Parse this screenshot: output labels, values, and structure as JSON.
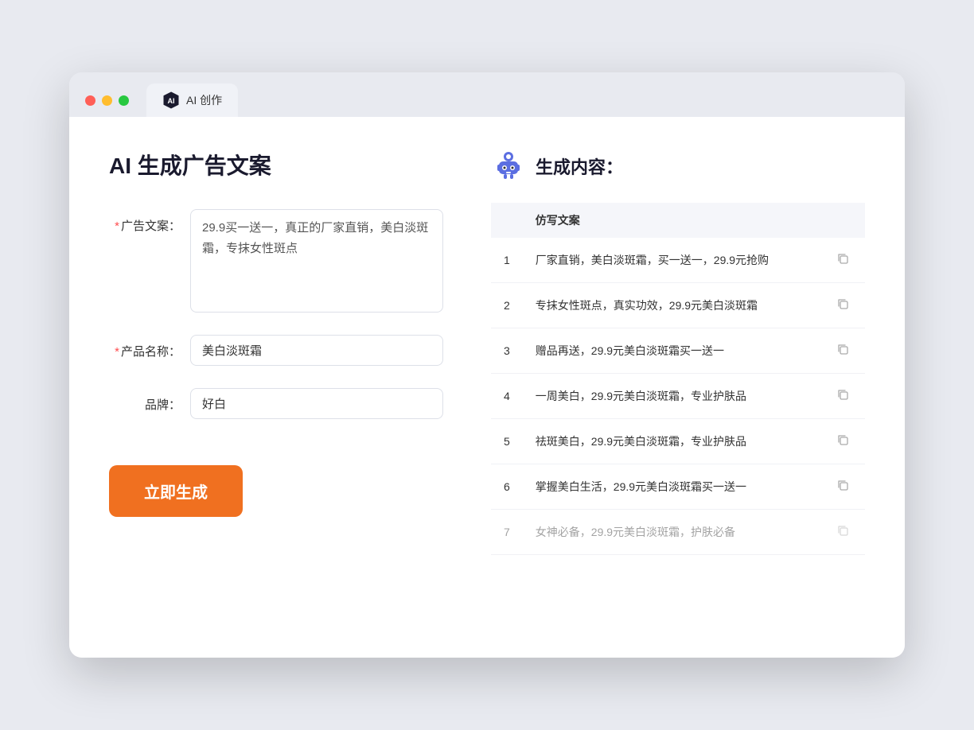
{
  "window": {
    "tab_label": "AI 创作"
  },
  "left": {
    "page_title": "AI 生成广告文案",
    "fields": [
      {
        "label": "广告文案：",
        "required": true,
        "type": "textarea",
        "value": "29.9买一送一，真正的厂家直销，美白淡斑霜，专抹女性斑点",
        "name": "ad-copy-input"
      },
      {
        "label": "产品名称：",
        "required": true,
        "type": "input",
        "value": "美白淡斑霜",
        "name": "product-name-input"
      },
      {
        "label": "品牌：",
        "required": false,
        "type": "input",
        "value": "好白",
        "name": "brand-input"
      }
    ],
    "generate_btn": "立即生成"
  },
  "right": {
    "title": "生成内容：",
    "table_header": "仿写文案",
    "results": [
      {
        "num": "1",
        "text": "厂家直销，美白淡斑霜，买一送一，29.9元抢购"
      },
      {
        "num": "2",
        "text": "专抹女性斑点，真实功效，29.9元美白淡斑霜"
      },
      {
        "num": "3",
        "text": "赠品再送，29.9元美白淡斑霜买一送一"
      },
      {
        "num": "4",
        "text": "一周美白，29.9元美白淡斑霜，专业护肤品"
      },
      {
        "num": "5",
        "text": "祛斑美白，29.9元美白淡斑霜，专业护肤品"
      },
      {
        "num": "6",
        "text": "掌握美白生活，29.9元美白淡斑霜买一送一"
      },
      {
        "num": "7",
        "text": "女神必备，29.9元美白淡斑霜，护肤必备"
      }
    ]
  },
  "colors": {
    "orange": "#f07020",
    "purple": "#6c7ae0",
    "red": "#ff5f57",
    "yellow": "#ffbd2e",
    "green": "#28c840"
  }
}
